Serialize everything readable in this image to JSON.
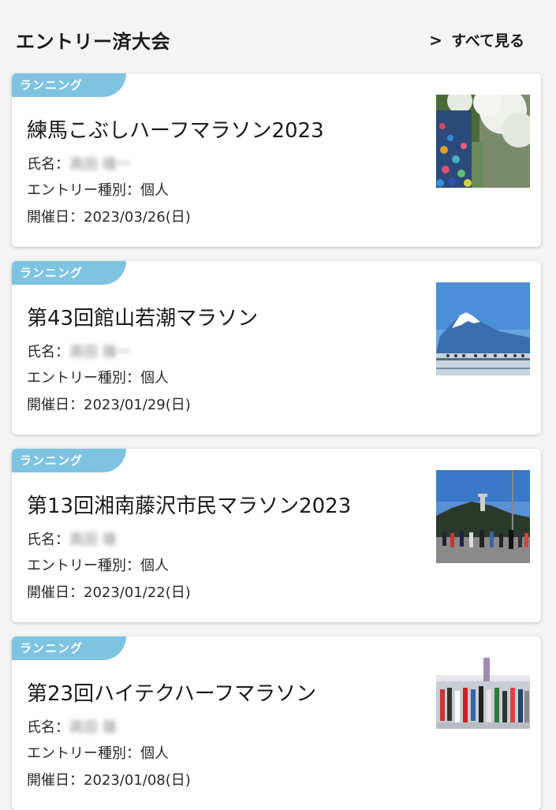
{
  "header": {
    "title": "エントリー済大会",
    "see_all_label": "すべて見る"
  },
  "cards": [
    {
      "category": "ランニング",
      "title": "練馬こぶしハーフマラソン2023",
      "name_label": "氏名：",
      "name_value": "高田 雄一",
      "entry_type_label": "エントリー種別：",
      "entry_type_value": "個人",
      "date_label": "開催日：",
      "date_value": "2023/03/26(日)",
      "image_icon": "runners-under-cherry-blossoms-photo"
    },
    {
      "category": "ランニング",
      "title": "第43回館山若潮マラソン",
      "name_label": "氏名：",
      "name_value": "高田 雄一",
      "entry_type_label": "エントリー種別：",
      "entry_type_value": "個人",
      "date_label": "開催日：",
      "date_value": "2023/01/29(日)",
      "image_icon": "mount-fuji-bridge-photo"
    },
    {
      "category": "ランニング",
      "title": "第13回湘南藤沢市民マラソン2023",
      "name_label": "氏名：",
      "name_value": "高田 雄",
      "entry_type_label": "エントリー種別：",
      "entry_type_value": "個人",
      "date_label": "開催日：",
      "date_value": "2023/01/22(日)",
      "image_icon": "enoshima-runners-photo"
    },
    {
      "category": "ランニング",
      "title": "第23回ハイテクハーフマラソン",
      "name_label": "氏名：",
      "name_value": "高田 雄",
      "entry_type_label": "エントリー種別：",
      "entry_type_value": "個人",
      "date_label": "開催日：",
      "date_value": "2023/01/08(日)",
      "image_icon": "marathon-start-runners-photo"
    }
  ],
  "colors": {
    "badge": "#7ec3e2",
    "background": "#f4f4f4",
    "card": "#ffffff",
    "text": "#1a1a1a"
  }
}
